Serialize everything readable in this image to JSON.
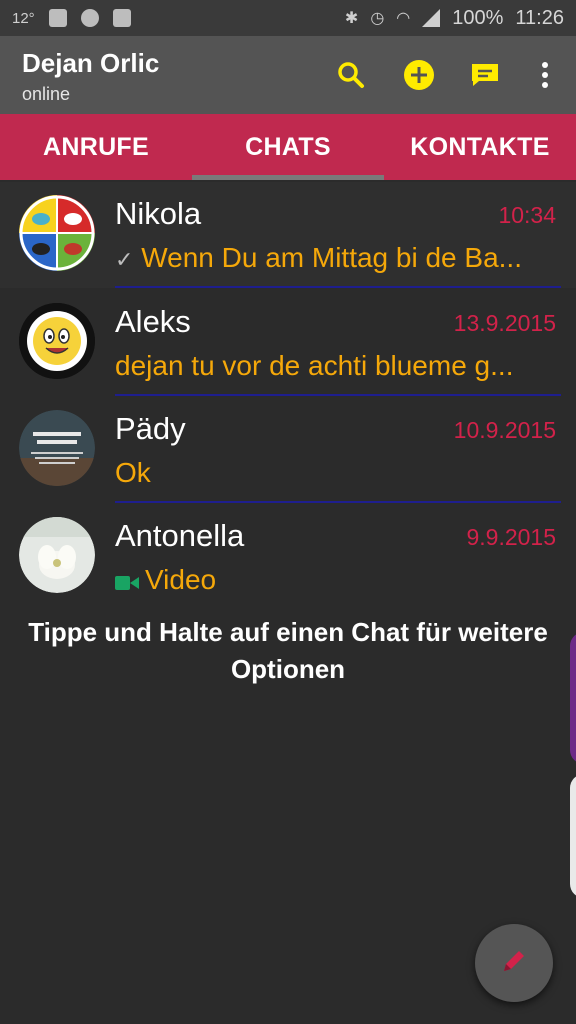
{
  "status_bar": {
    "temperature": "12°",
    "battery": "100%",
    "time": "11:26"
  },
  "app_bar": {
    "title": "Dejan Orlic",
    "subtitle": "online",
    "icons": [
      "search-icon",
      "new-group-icon",
      "new-chat-icon",
      "more-options-icon"
    ]
  },
  "tabs": [
    {
      "label": "ANRUFE",
      "selected": false
    },
    {
      "label": "CHATS",
      "selected": true
    },
    {
      "label": "KONTAKTE",
      "selected": false
    }
  ],
  "chats": [
    {
      "name": "Nikola",
      "time": "10:34",
      "preview": "Wenn Du am Mittag bi de Ba...",
      "read_check": "✓"
    },
    {
      "name": "Aleks",
      "time": "13.9.2015",
      "preview": "dejan tu vor de achti blueme g..."
    },
    {
      "name": "Pädy",
      "time": "10.9.2015",
      "preview": "Ok"
    },
    {
      "name": "Antonella",
      "time": "9.9.2015",
      "preview": "Video",
      "preview_icon": "video-icon"
    }
  ],
  "hint": "Tippe und Halte auf einen Chat für weitere Optionen",
  "colors": {
    "accent": "#c0294f",
    "time_red": "#d2224a",
    "preview_yellow": "#f5a80a",
    "icon_yellow": "#ffeb00",
    "background": "#2b2b2b"
  }
}
